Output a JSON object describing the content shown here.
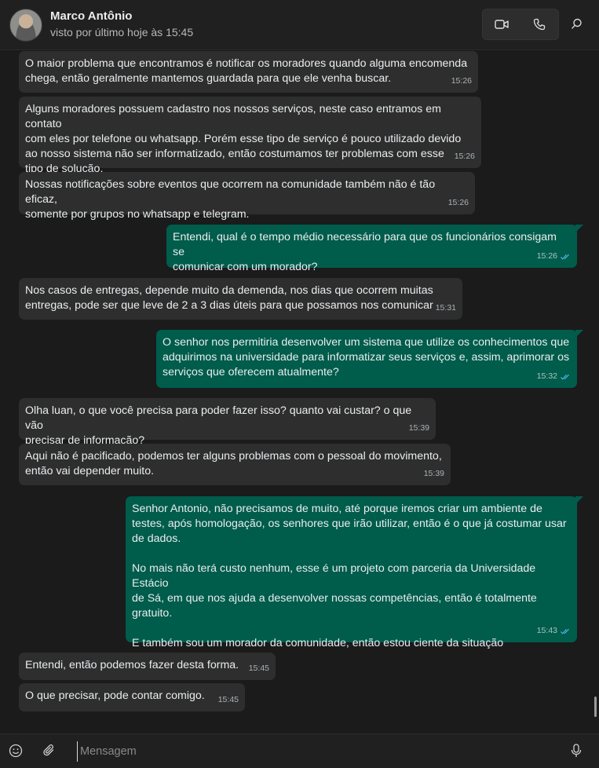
{
  "header": {
    "contact_name": "Marco Antônio",
    "status": "visto por último hoje às 15:45",
    "icons": {
      "video": "video-call-icon",
      "voice": "voice-call-icon",
      "search": "search-icon"
    }
  },
  "colors": {
    "incoming_bubble": "#2e2e2e",
    "outgoing_bubble": "#005c4b",
    "read_receipt": "#53bdeb",
    "background": "#1b1b1b"
  },
  "messages": [
    {
      "direction": "in",
      "text": "O maior problema que encontramos é notificar os moradores quando alguma encomenda\nchega, então geralmente mantemos guardada para que ele venha buscar.",
      "time": "15:26"
    },
    {
      "direction": "in",
      "text": "Alguns moradores possuem cadastro nos nossos serviços, neste caso entramos em contato\ncom eles por telefone ou whatsapp. Porém esse tipo de serviço é pouco utilizado devido\nao nosso sistema não ser informatizado, então costumamos ter problemas com esse\ntipo de solução.",
      "time": "15:26"
    },
    {
      "direction": "in",
      "text": "Nossas notificações sobre eventos que ocorrem na comunidade também não é tão eficaz,\nsomente por grupos no whatsapp e telegram.",
      "time": "15:26"
    },
    {
      "direction": "out",
      "text": "Entendi, qual é o tempo médio necessário para que os funcionários consigam se\ncomunicar com um morador?",
      "time": "15:26"
    },
    {
      "direction": "in",
      "text": "Nos casos de entregas, depende muito da demenda, nos dias que ocorrem muitas\nentregas, pode ser que leve de 2 a 3 dias úteis para que possamos nos comunicar",
      "time": "15:31"
    },
    {
      "direction": "out",
      "text": "O senhor nos permitiria desenvolver um sistema que utilize os conhecimentos que\nadquirimos na universidade para informatizar seus serviços e, assim, aprimorar os\nserviços que oferecem atualmente?",
      "time": "15:32"
    },
    {
      "direction": "in",
      "text": "Olha luan, o que você precisa para poder fazer isso? quanto vai custar? o que vão\nprecisar de informação?",
      "time": "15:39"
    },
    {
      "direction": "in",
      "text": "Aqui não é pacificado, podemos ter alguns problemas com o pessoal do movimento,\nentão vai depender muito.",
      "time": "15:39"
    },
    {
      "direction": "out",
      "text": "Senhor Antonio, não precisamos de muito, até porque iremos criar um ambiente de\ntestes, após homologação, os senhores que irão utilizar, então é o que já costumar usar\nde dados.\n\nNo mais não terá custo nenhum, esse é um projeto com parceria da Universidade Estácio\nde Sá, em que nos ajuda a desenvolver nossas competências, então é totalmente\ngratuito.\n\nE também sou um morador da comunidade, então estou ciente da situação",
      "time": "15:43"
    },
    {
      "direction": "in",
      "text": "Entendi, então podemos fazer desta forma.",
      "time": "15:45"
    },
    {
      "direction": "in",
      "text": "O que precisar, pode contar comigo.",
      "time": "15:45"
    }
  ],
  "composer": {
    "placeholder": "Mensagem",
    "icons": {
      "emoji": "emoji-icon",
      "attach": "paperclip-icon",
      "mic": "microphone-icon"
    }
  }
}
